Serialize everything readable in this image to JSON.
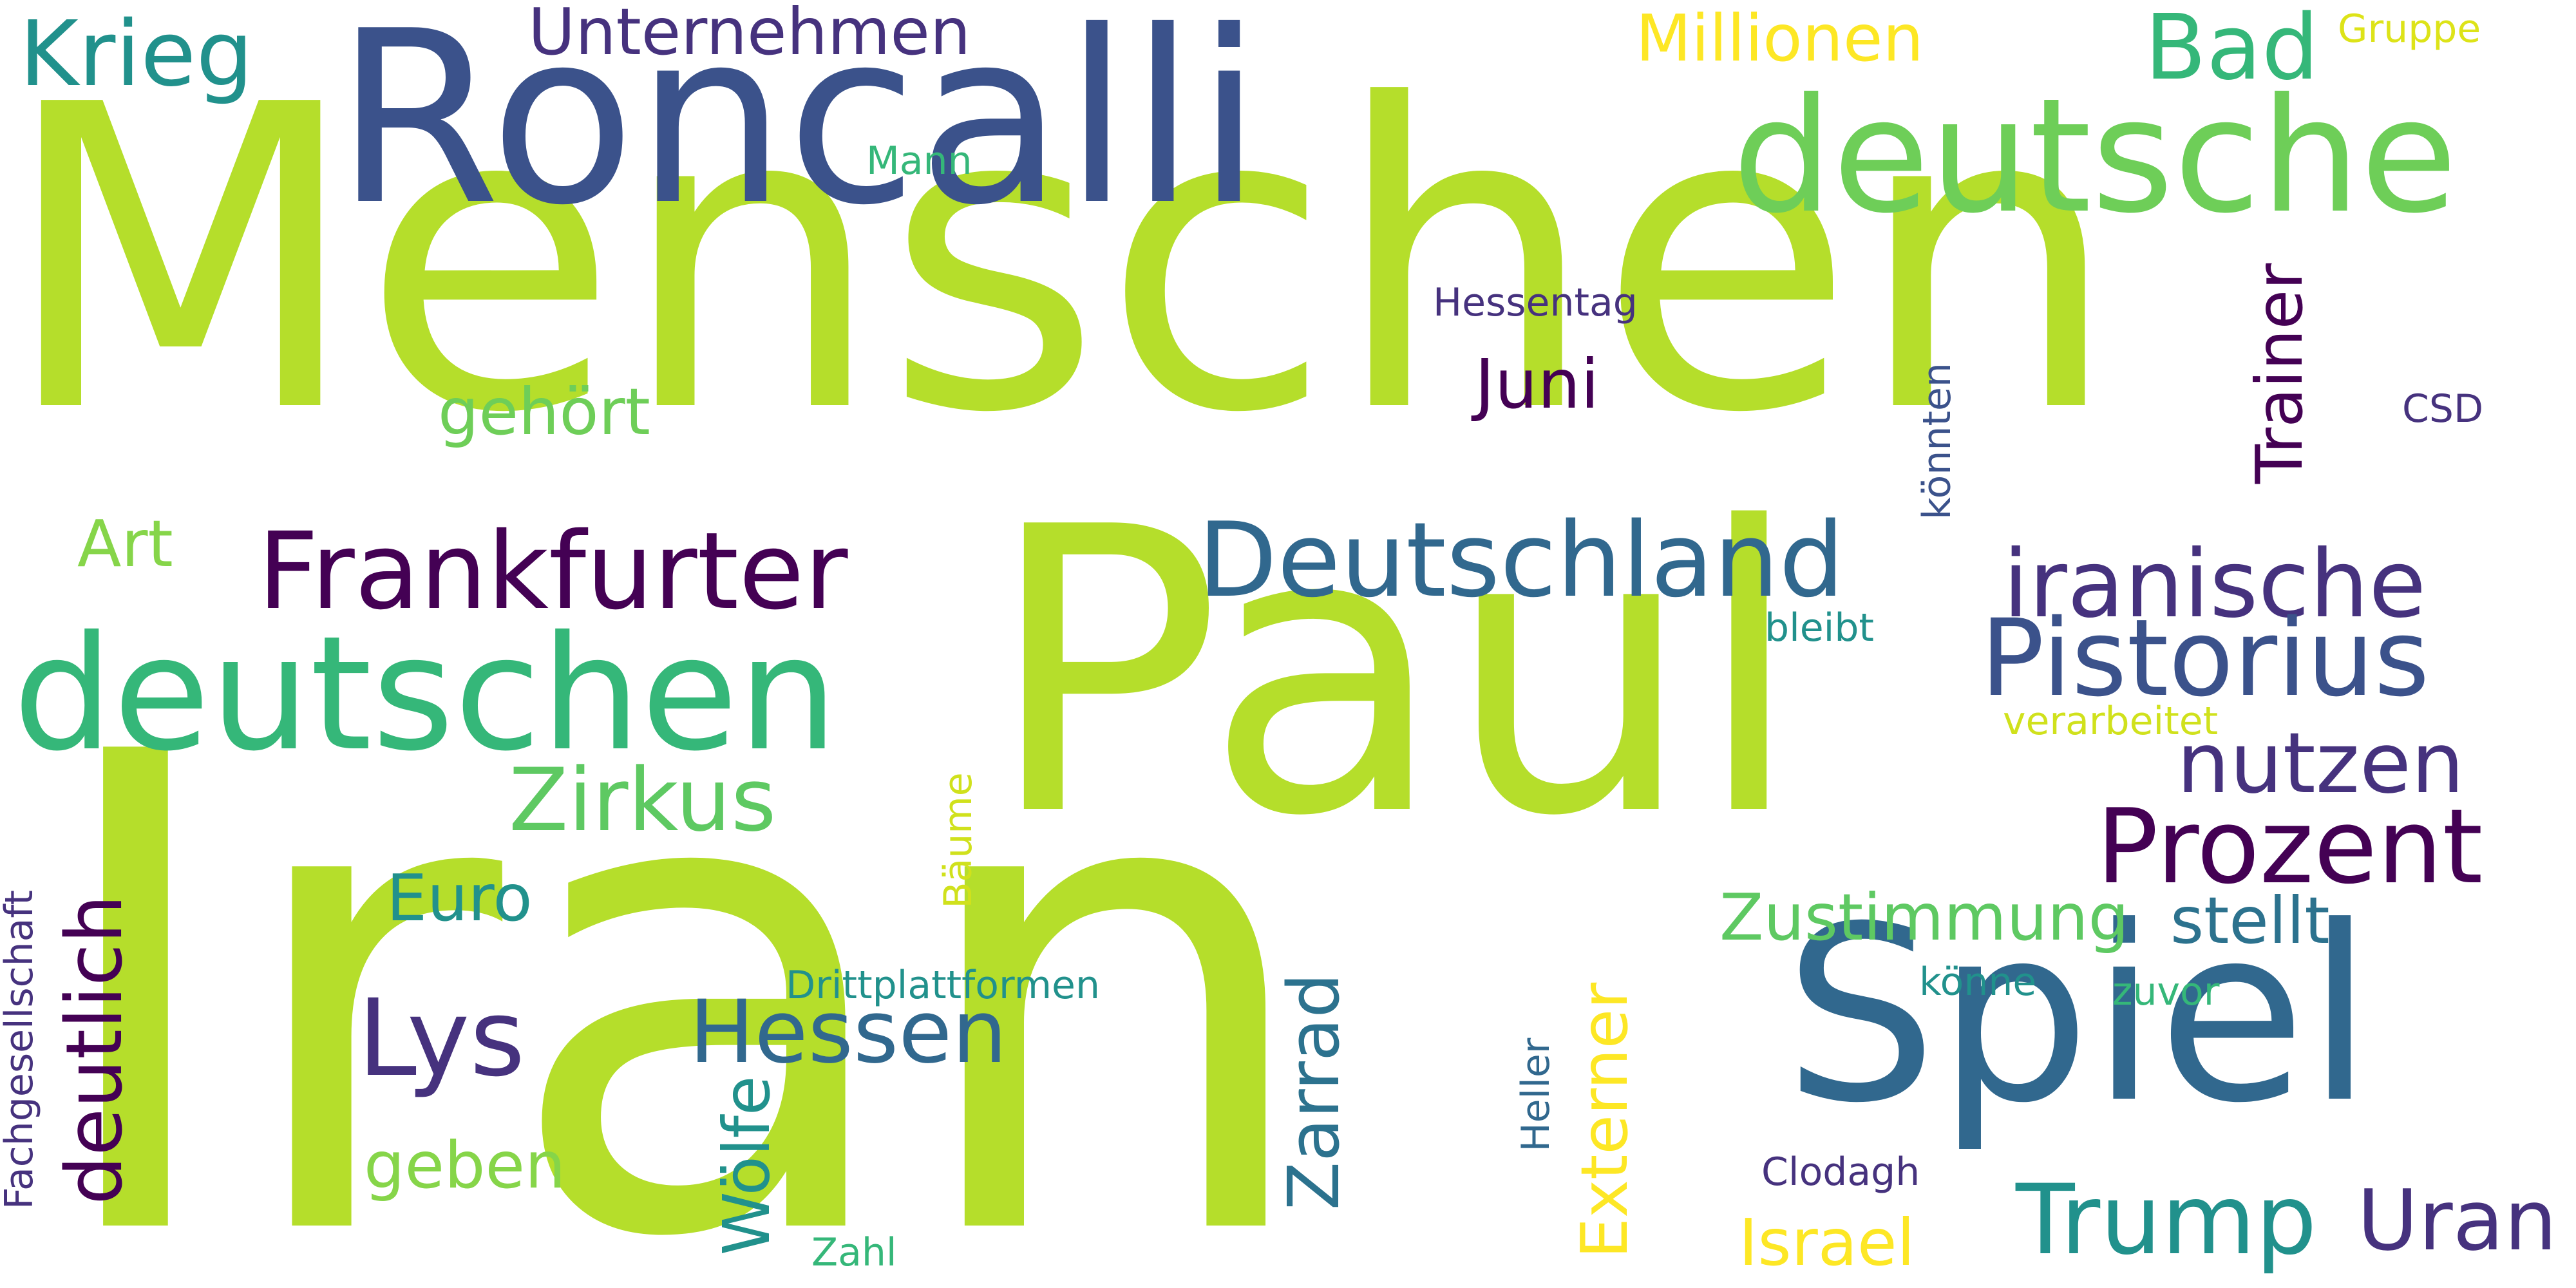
{
  "words": [
    {
      "text": "Menschen",
      "color": "#b5de2b"
    },
    {
      "text": "Iran",
      "color": "#b5de2b"
    },
    {
      "text": "Paul",
      "color": "#b5de2b"
    },
    {
      "text": "Roncalli",
      "color": "#3b528b"
    },
    {
      "text": "deutsche",
      "color": "#6ece58"
    },
    {
      "text": "deutschen",
      "color": "#35b779"
    },
    {
      "text": "Spiel",
      "color": "#31688e"
    },
    {
      "text": "Frankfurter",
      "color": "#440154"
    },
    {
      "text": "Deutschland",
      "color": "#31688e"
    },
    {
      "text": "iranische",
      "color": "#46327e"
    },
    {
      "text": "Pistorius",
      "color": "#3b528b"
    },
    {
      "text": "Prozent",
      "color": "#440154"
    },
    {
      "text": "nutzen",
      "color": "#46327e"
    },
    {
      "text": "Zirkus",
      "color": "#5ec962"
    },
    {
      "text": "Krieg",
      "color": "#21918c"
    },
    {
      "text": "Unternehmen",
      "color": "#46327e"
    },
    {
      "text": "Millionen",
      "color": "#fde725"
    },
    {
      "text": "Bad",
      "color": "#35b779"
    },
    {
      "text": "Gruppe",
      "color": "#dde318"
    },
    {
      "text": "Mann",
      "color": "#35b779"
    },
    {
      "text": "Trainer",
      "color": "#440154"
    },
    {
      "text": "Hessentag",
      "color": "#46327e"
    },
    {
      "text": "Juni",
      "color": "#440154"
    },
    {
      "text": "gehört",
      "color": "#6ece58"
    },
    {
      "text": "könnten",
      "color": "#3b528b"
    },
    {
      "text": "CSD",
      "color": "#46327e"
    },
    {
      "text": "Art",
      "color": "#86d549"
    },
    {
      "text": "bleibt",
      "color": "#21918c"
    },
    {
      "text": "verarbeitet",
      "color": "#d0e11c"
    },
    {
      "text": "deutlich",
      "color": "#440154"
    },
    {
      "text": "Bäume",
      "color": "#d0e11c"
    },
    {
      "text": "Euro",
      "color": "#21918c"
    },
    {
      "text": "Zustimmung",
      "color": "#5ec962"
    },
    {
      "text": "stellt",
      "color": "#2c728e"
    },
    {
      "text": "Fachgesellschaft",
      "color": "#46327e"
    },
    {
      "text": "Lys",
      "color": "#46327e"
    },
    {
      "text": "Hessen",
      "color": "#31688e"
    },
    {
      "text": "Drittplattformen",
      "color": "#21918c"
    },
    {
      "text": "könne",
      "color": "#21918c"
    },
    {
      "text": "zuvor",
      "color": "#35b779"
    },
    {
      "text": "Zarrad",
      "color": "#2c728e"
    },
    {
      "text": "Heller",
      "color": "#31688e"
    },
    {
      "text": "Externer",
      "color": "#fde725"
    },
    {
      "text": "geben",
      "color": "#86d549"
    },
    {
      "text": "Wölfe",
      "color": "#21918c"
    },
    {
      "text": "Clodagh",
      "color": "#46327e"
    },
    {
      "text": "Trump",
      "color": "#21918c"
    },
    {
      "text": "Uran",
      "color": "#46327e"
    },
    {
      "text": "Israel",
      "color": "#fde725"
    },
    {
      "text": "Zahl",
      "color": "#35b779"
    }
  ]
}
